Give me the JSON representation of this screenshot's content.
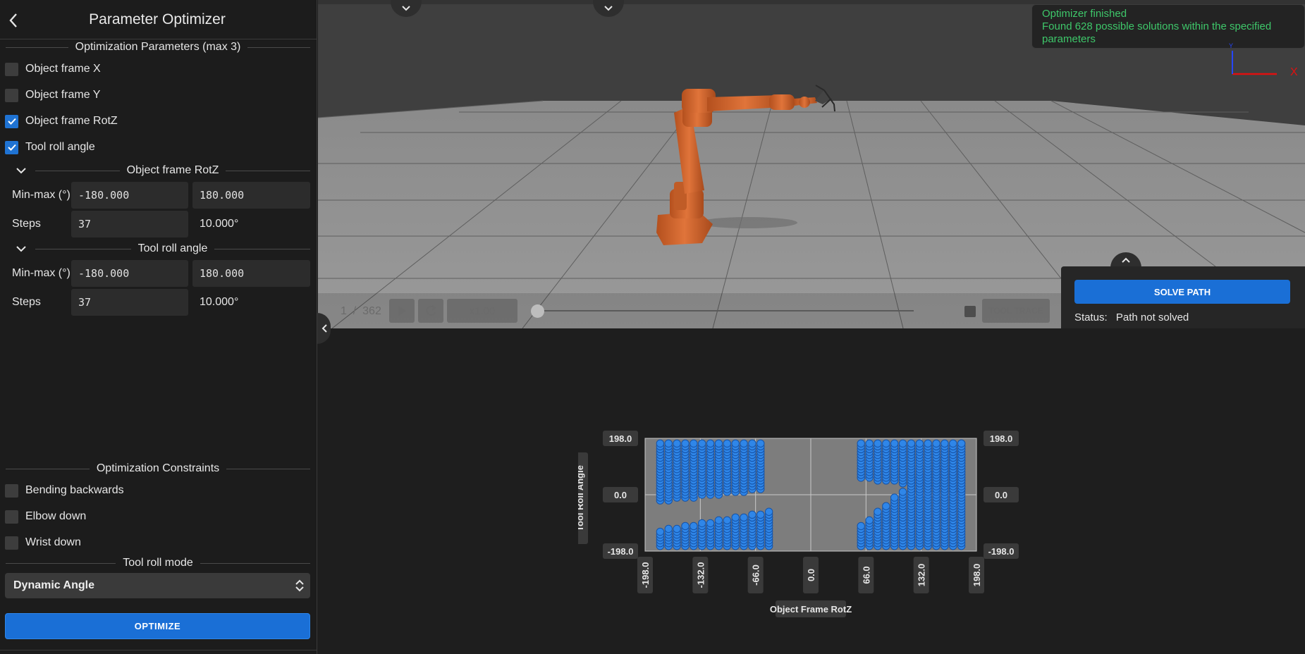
{
  "panel": {
    "title": "Parameter Optimizer",
    "params_title": "Optimization Parameters (max 3)",
    "params": [
      {
        "label": "Object frame X",
        "checked": false
      },
      {
        "label": "Object frame Y",
        "checked": false
      },
      {
        "label": "Object frame RotZ",
        "checked": true
      },
      {
        "label": "Tool roll angle",
        "checked": true
      }
    ],
    "groups": [
      {
        "title": "Object frame RotZ",
        "minmax_label": "Min-max (°)",
        "min": "-180.000",
        "max": "180.000",
        "steps_label": "Steps",
        "steps": "37",
        "step_size": "10.000°"
      },
      {
        "title": "Tool roll angle",
        "minmax_label": "Min-max (°)",
        "min": "-180.000",
        "max": "180.000",
        "steps_label": "Steps",
        "steps": "37",
        "step_size": "10.000°"
      }
    ],
    "constraints_title": "Optimization Constraints",
    "constraints": [
      {
        "label": "Bending backwards",
        "checked": false
      },
      {
        "label": "Elbow down",
        "checked": false
      },
      {
        "label": "Wrist down",
        "checked": false
      }
    ],
    "roll_mode_title": "Tool roll mode",
    "roll_mode_value": "Dynamic Angle",
    "optimize_label": "OPTIMIZE"
  },
  "viewport": {
    "toast_line1": "Optimizer finished",
    "toast_line2": "Found 628 possible solutions within the specified parameters",
    "axis_x": "X",
    "axis_y": "Y",
    "frame_current": "1",
    "frame_sep": "/",
    "frame_total": "362",
    "speed": "x1.00",
    "tool_trace": "TOOL TRACE",
    "solve_label": "SOLVE PATH",
    "status_label": "Status:",
    "status_value": "Path not solved"
  },
  "colors": {
    "accent": "#1a6fd6",
    "toast_text": "#3ec76a",
    "robot": "#d2642a",
    "points": "#2f86e8"
  },
  "chart_data": {
    "type": "scatter",
    "xlabel": "Object Frame RotZ",
    "ylabel": "Tool Roll Angle",
    "xlim": [
      -198,
      198
    ],
    "ylim": [
      -198,
      198
    ],
    "x_ticks": [
      "-198.0",
      "-132.0",
      "-66.0",
      "0.0",
      "66.0",
      "132.0",
      "198.0"
    ],
    "y_ticks": [
      "198.0",
      "0.0",
      "-198.0"
    ],
    "step_x": 10,
    "step_y": 10,
    "point_count": 628,
    "regions": [
      {
        "x": [
          -180,
          -60
        ],
        "y_low": [
          -20,
          20
        ],
        "y_high": 180
      },
      {
        "x": [
          -180,
          -50
        ],
        "y_low": -180,
        "y_high": [
          -130,
          -60
        ]
      },
      {
        "x": [
          60,
          180
        ],
        "y_low": -180,
        "y_high": [
          -110,
          180
        ]
      },
      {
        "x": [
          60,
          180
        ],
        "y_low": [
          60,
          20
        ],
        "y_high": 180
      }
    ]
  }
}
